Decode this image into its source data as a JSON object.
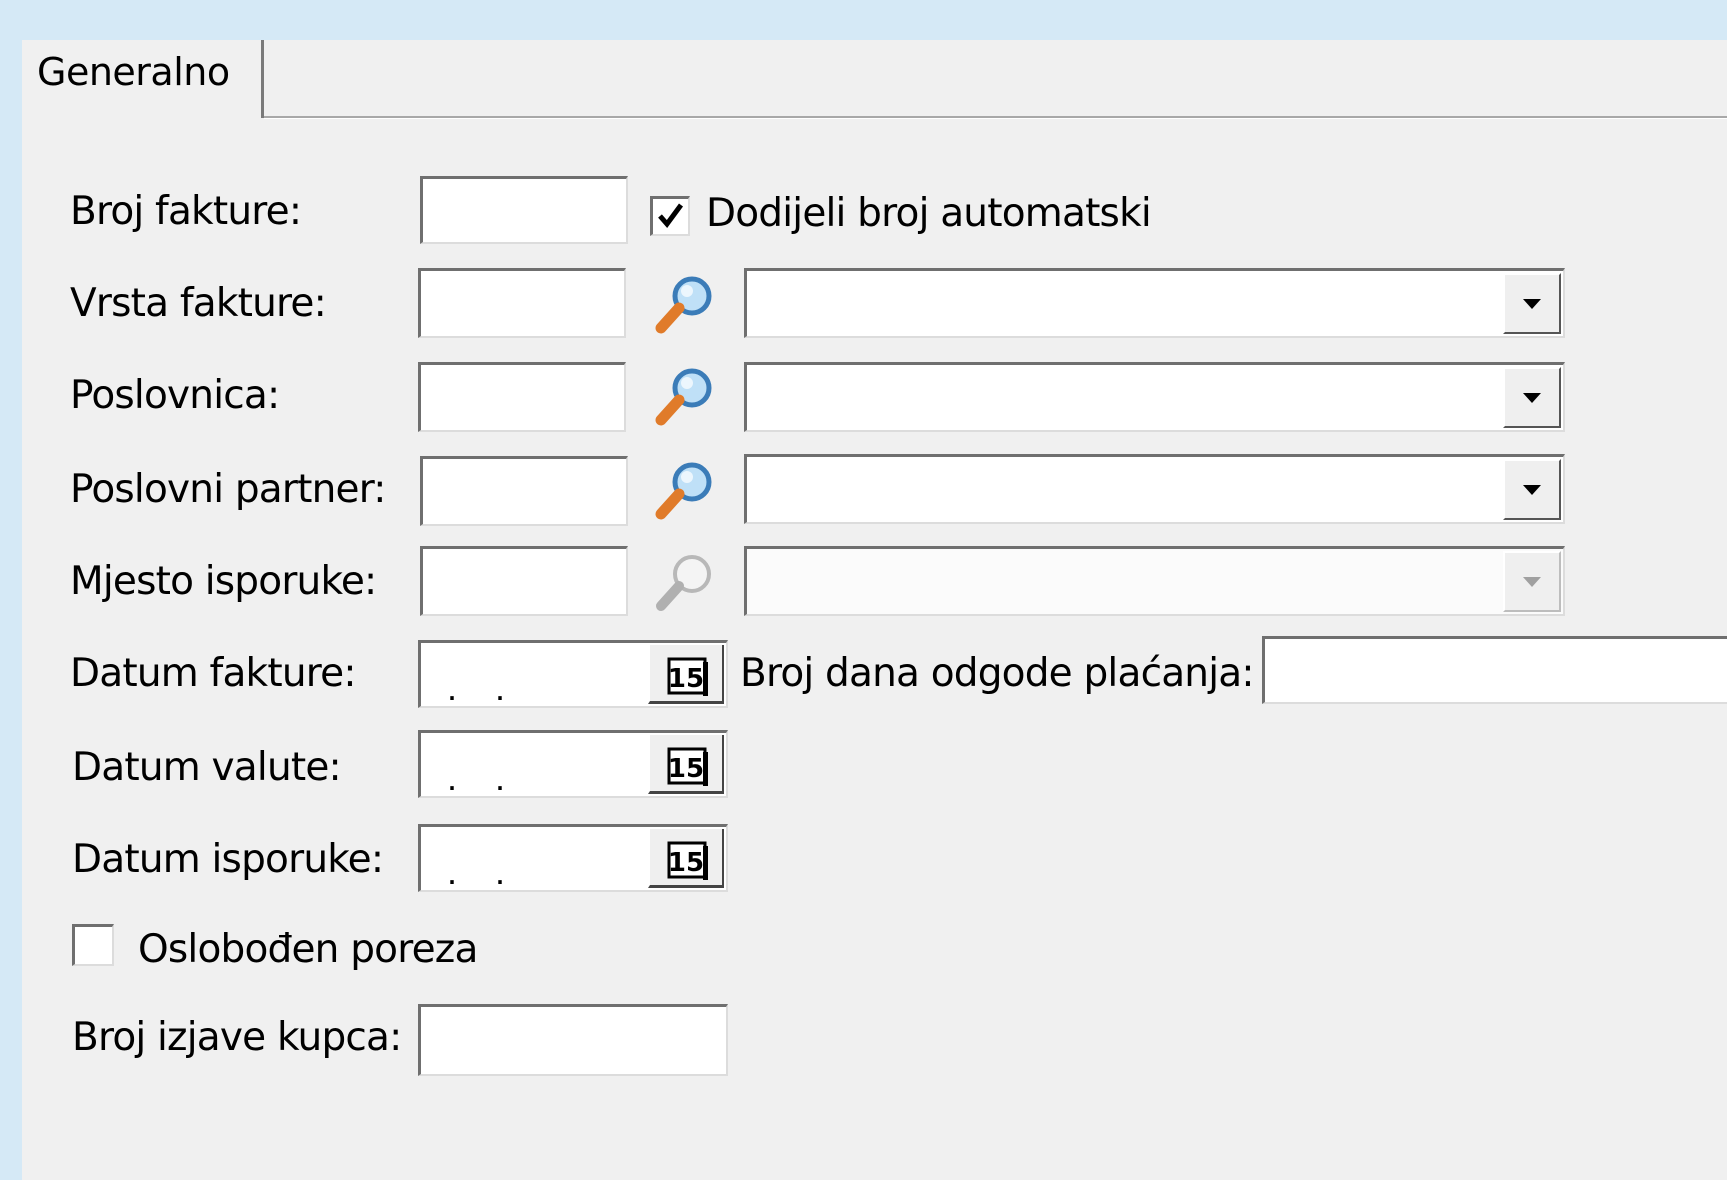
{
  "tab": {
    "label": "Generalno"
  },
  "fields": {
    "broj_fakture": {
      "label": "Broj fakture:",
      "value": ""
    },
    "dodijeli": {
      "label": "Dodijeli broj automatski",
      "checked": true
    },
    "vrsta_fakture": {
      "label": "Vrsta fakture:",
      "code": "",
      "selected": ""
    },
    "poslovnica": {
      "label": "Poslovnica:",
      "code": "",
      "selected": ""
    },
    "poslovni_partner": {
      "label": "Poslovni partner:",
      "code": "",
      "selected": ""
    },
    "mjesto_isporuke": {
      "label": "Mjesto isporuke:",
      "code": "",
      "selected": ""
    },
    "datum_fakture": {
      "label": "Datum fakture:",
      "value": ". ."
    },
    "broj_dana": {
      "label": "Broj dana odgode plaćanja:",
      "value": ""
    },
    "datum_valute": {
      "label": "Datum valute:",
      "value": ". ."
    },
    "datum_isporuke": {
      "label": "Datum isporuke:",
      "value": ". ."
    },
    "oslobodjen": {
      "label": "Oslobođen poreza",
      "checked": false
    },
    "broj_izjave": {
      "label": "Broj izjave kupca:",
      "value": ""
    }
  },
  "calendar_icon": {
    "name": "calendar-icon",
    "text": "15"
  },
  "search_icon": {
    "name": "magnifier-icon"
  },
  "colors": {
    "background": "#d5e9f6",
    "panel": "#f0f0f0",
    "magnifier_handle": "#e07b2a",
    "magnifier_lens": "#6aa9d8"
  }
}
